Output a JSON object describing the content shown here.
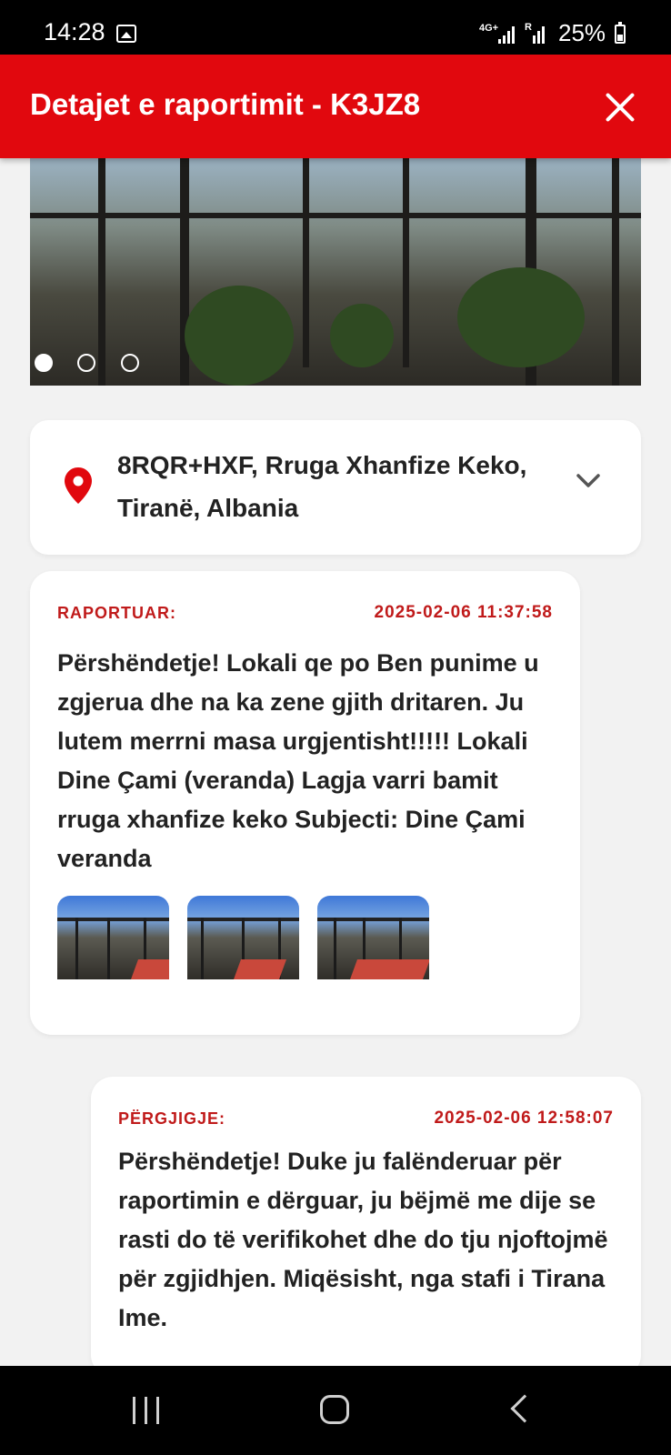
{
  "status_bar": {
    "time": "14:28",
    "network": "4G+",
    "sim_label": "R",
    "battery": "25%",
    "icons": [
      "gallery-icon",
      "signal-icon",
      "battery-icon"
    ]
  },
  "header": {
    "title": "Detajet e raportimit - K3JZ8",
    "close_icon": "close-icon",
    "background": "#e1080e"
  },
  "carousel": {
    "image_count": 3,
    "active_index": 0
  },
  "location": {
    "address": "8RQR+HXF, Rruga Xhanfize Keko, Tiranë, Albania",
    "pin_icon": "map-pin-icon",
    "expand_icon": "chevron-down-icon",
    "pin_color": "#e1080e"
  },
  "report": {
    "label": "RAPORTUAR:",
    "date": "2025-02-06 11:37:58",
    "text": "Përshëndetje! Lokali qe po Ben punime u zgjerua dhe na ka zene gjith dritaren. Ju lutem merrni masa urgjentisht!!!!! Lokali Dine Çami (veranda) Lagja varri bamit rruga xhanfize keko Subjecti: Dine Çami veranda",
    "attachment_count": 3
  },
  "response": {
    "label": "PËRGJIGJE:",
    "date": "2025-02-06 12:58:07",
    "text": "Përshëndetje! Duke ju falënderuar për raportimin e dërguar, ju bëjmë me dije se rasti do të verifikohet dhe do tju njoftojmë për zgjidhjen. Miqësisht, nga stafi i Tirana Ime."
  },
  "nav_bar": {
    "icons": [
      "recents-icon",
      "home-icon",
      "back-icon"
    ]
  },
  "colors": {
    "accent": "#e1080e",
    "label_red": "#c01a1a",
    "page_background": "#f2f2f2"
  }
}
